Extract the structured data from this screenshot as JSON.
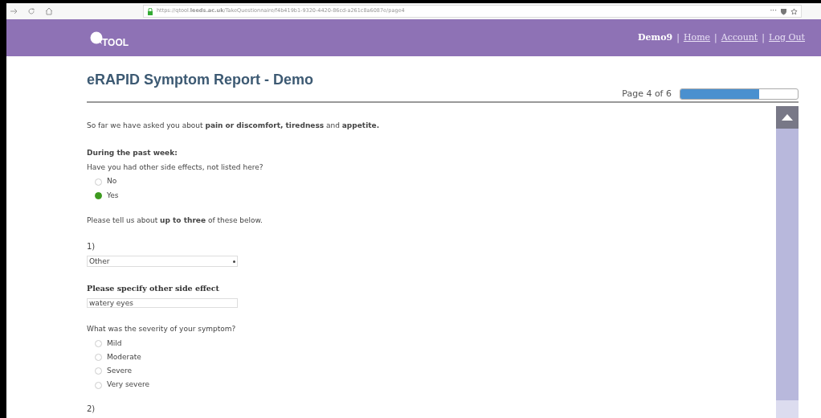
{
  "browser": {
    "url": "https://qtool.**leeds.ac.uk**/TakeQuestionnaire/f4b419b1-9320-4420-86cd-a261c8a6087e/page4",
    "menu": "···"
  },
  "header": {
    "logo": "TOOL",
    "user": "Demo9",
    "separator": "|",
    "links": [
      "Home",
      "Account",
      "Log Out"
    ]
  },
  "title": "eRAPID Symptom Report - Demo",
  "progress": {
    "label": "Page 4 of 6",
    "level": 0.67
  },
  "intro": "So far we have asked you about **pain or discomfort, tiredness** and **appetite.**",
  "question": {
    "heading": "During the past week:",
    "prompt": "Have you had other side effects, not listed here?",
    "options": [
      {
        "label": "No",
        "selected": false
      },
      {
        "label": "Yes",
        "selected": true
      }
    ]
  },
  "instruction": "Please tell us about **up to three** of these below.",
  "items": [
    {
      "number": "1)",
      "select": "Other",
      "specify_label": "Please specify other side effect",
      "specify_value": "watery eyes",
      "severity_prompt": "What was the severity of your symptom?",
      "severity_options": [
        {
          "label": "Mild",
          "selected": false
        },
        {
          "label": "Moderate",
          "selected": false
        },
        {
          "label": "Severe",
          "selected": false
        },
        {
          "label": "Very severe",
          "selected": false
        }
      ]
    },
    {
      "number": "2)"
    }
  ]
}
